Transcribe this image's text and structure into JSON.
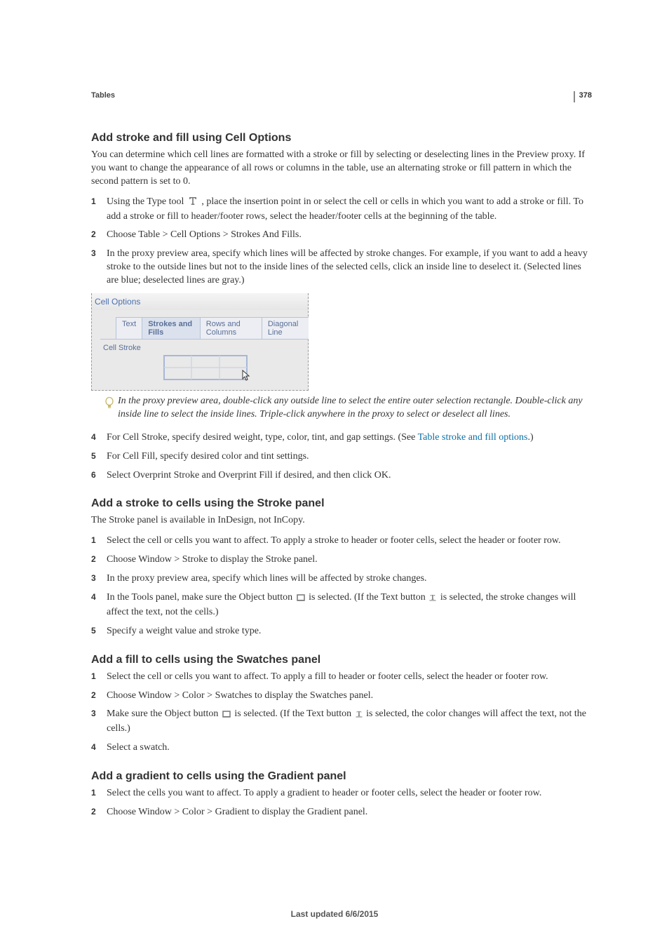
{
  "page_number": "378",
  "breadcrumb": "Tables",
  "s1": {
    "heading": "Add stroke and fill using Cell Options",
    "intro": "You can determine which cell lines are formatted with a stroke or fill by selecting or deselecting lines in the Preview proxy. If you want to change the appearance of all rows or columns in the table, use an alternating stroke or fill pattern in which the second pattern is set to 0.",
    "steps": {
      "1a": "Using the Type tool ",
      "1b": " , place the insertion point in or select the cell or cells in which you want to add a stroke or fill. To add a stroke or fill to header/footer rows, select the header/footer cells at the beginning of the table.",
      "2": "Choose Table > Cell Options > Strokes And Fills.",
      "3": "In the proxy preview area, specify which lines will be affected by stroke changes. For example, if you want to add a heavy stroke to the outside lines but not to the inside lines of the selected cells, click an inside line to deselect it. (Selected lines are blue; deselected lines are gray.)",
      "4a": "For Cell Stroke, specify desired weight, type, color, tint, and gap settings. (See ",
      "4link": "Table stroke and fill options",
      "4b": ".)",
      "5": "For Cell Fill, specify desired color and tint settings.",
      "6": "Select Overprint Stroke and Overprint Fill if desired, and then click OK."
    },
    "dialog": {
      "title": "Cell Options",
      "tabs": [
        "Text",
        "Strokes and Fills",
        "Rows and Columns",
        "Diagonal Line"
      ],
      "section_label": "Cell Stroke"
    },
    "tip": "In the proxy preview area, double-click any outside line to select the entire outer selection rectangle. Double-click any inside line to select the inside lines. Triple-click anywhere in the proxy to select or deselect all lines."
  },
  "s2": {
    "heading": "Add a stroke to cells using the Stroke panel",
    "intro": "The Stroke panel is available in InDesign, not InCopy.",
    "steps": {
      "1": "Select the cell or cells you want to affect. To apply a stroke to header or footer cells, select the header or footer row.",
      "2": "Choose Window > Stroke to display the Stroke panel.",
      "3": "In the proxy preview area, specify which lines will be affected by stroke changes.",
      "4a": "In the Tools panel, make sure the Object button ",
      "4b": " is selected. (If the Text button ",
      "4c": " is selected, the stroke changes will affect the text, not the cells.)",
      "5": "Specify a weight value and stroke type."
    }
  },
  "s3": {
    "heading": "Add a fill to cells using the Swatches panel",
    "steps": {
      "1": "Select the cell or cells you want to affect. To apply a fill to header or footer cells, select the header or footer row.",
      "2": "Choose Window > Color > Swatches to display the Swatches panel.",
      "3a": "Make sure the Object button ",
      "3b": " is selected. (If the Text button ",
      "3c": " is selected, the color changes will affect the text, not the cells.)",
      "4": "Select a swatch."
    }
  },
  "s4": {
    "heading": "Add a gradient to cells using the Gradient panel",
    "steps": {
      "1": "Select the cells you want to affect. To apply a gradient to header or footer cells, select the header or footer row.",
      "2": "Choose Window > Color > Gradient to display the Gradient panel."
    }
  },
  "footer": "Last updated 6/6/2015"
}
